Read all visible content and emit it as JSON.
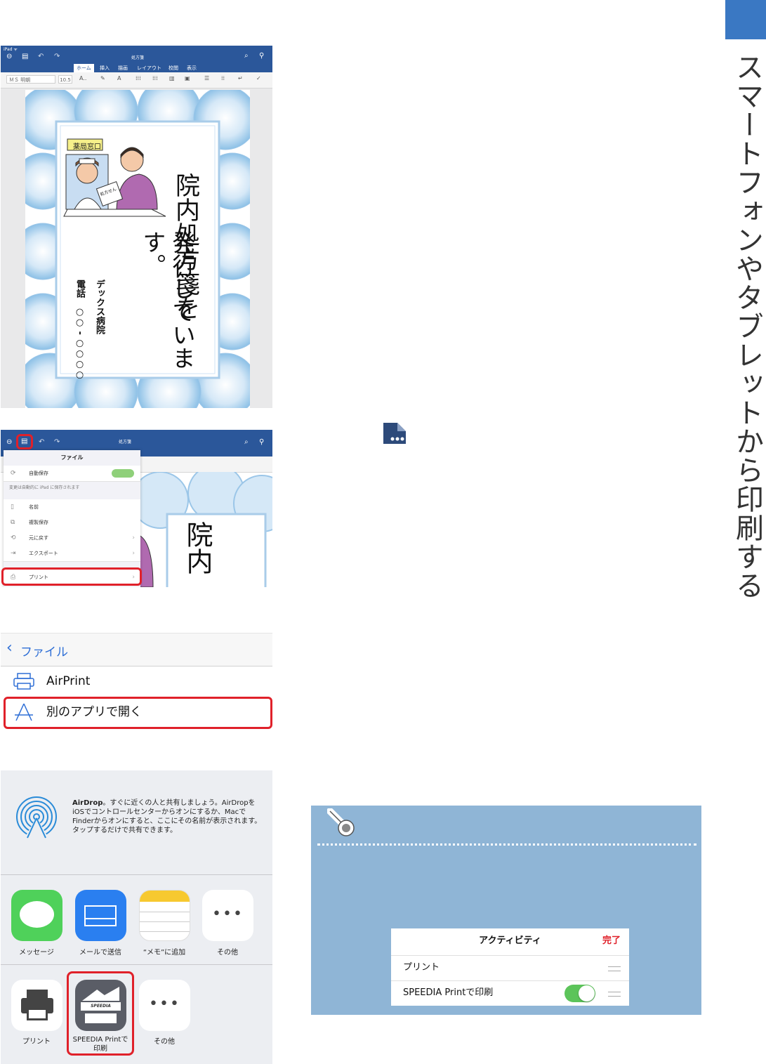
{
  "side": {
    "title": "スマートフォンやタブレットから印刷する",
    "accent": "#3a78c3"
  },
  "word_app": {
    "status": "iPad ᯤ",
    "doc_title": "処方箋",
    "tabs": [
      "ホーム",
      "挿入",
      "描画",
      "レイアウト",
      "校閲",
      "表示"
    ],
    "font_name": "ＭＳ 明朝",
    "font_size": "10.5",
    "brand_color": "#2b579a"
  },
  "document": {
    "sign_label": "薬局窓口",
    "paper_label": "処方せん",
    "main_line1": "院内処方箋を",
    "main_line2": "発行しています。",
    "hospital": "デックス病院",
    "phone": "電話　○○ - ○○○○"
  },
  "file_menu": {
    "header": "ファイル",
    "autosave": "自動保存",
    "autosave_note": "変更は自動的に iPad に保存されます",
    "items": [
      "名前",
      "複製保存",
      "元に戻す",
      "エクスポート"
    ],
    "print": "プリント",
    "preview_text": "院内"
  },
  "print_menu": {
    "back": "ファイル",
    "airprint": "AirPrint",
    "open_other": "別のアプリで開く",
    "highlight_color": "#e0212a"
  },
  "share_sheet": {
    "airdrop_title": "AirDrop",
    "airdrop_text": "。すぐに近くの人と共有しましょう。AirDropをiOSでコントロールセンターからオンにするか、MacでFinderからオンにすると、ここにその名前が表示されます。タップするだけで共有できます。",
    "apps": [
      "メッセージ",
      "メールで送信",
      "“メモ”に追加",
      "その他"
    ],
    "actions": [
      "プリント",
      "SPEEDIA Printで\n印刷",
      "その他"
    ],
    "speedia_logo": "SPEEDIA"
  },
  "activity": {
    "title": "アクティビティ",
    "done": "完了",
    "rows": [
      "プリント",
      "SPEEDIA Printで印刷"
    ],
    "toggle_on": true
  }
}
